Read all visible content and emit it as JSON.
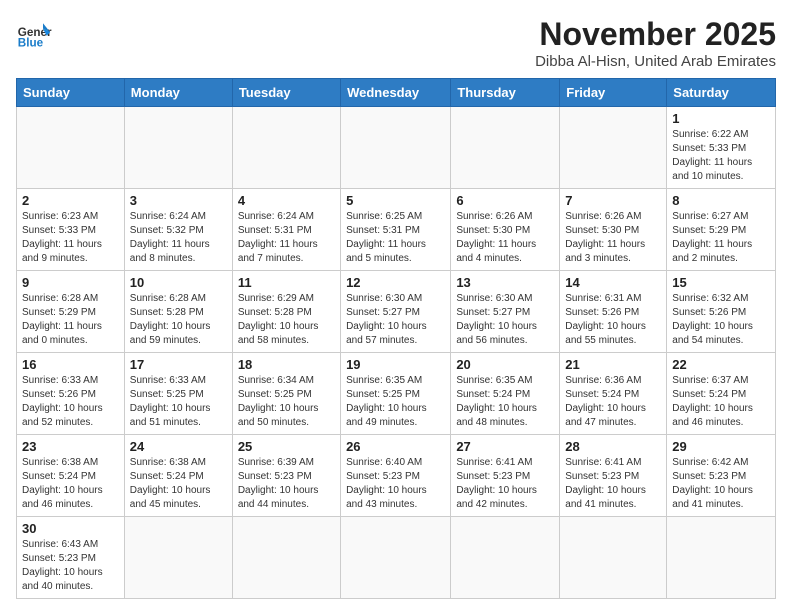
{
  "header": {
    "logo_general": "General",
    "logo_blue": "Blue",
    "month_title": "November 2025",
    "location": "Dibba Al-Hisn, United Arab Emirates"
  },
  "weekdays": [
    "Sunday",
    "Monday",
    "Tuesday",
    "Wednesday",
    "Thursday",
    "Friday",
    "Saturday"
  ],
  "weeks": [
    [
      {
        "day": "",
        "info": ""
      },
      {
        "day": "",
        "info": ""
      },
      {
        "day": "",
        "info": ""
      },
      {
        "day": "",
        "info": ""
      },
      {
        "day": "",
        "info": ""
      },
      {
        "day": "",
        "info": ""
      },
      {
        "day": "1",
        "info": "Sunrise: 6:22 AM\nSunset: 5:33 PM\nDaylight: 11 hours and 10 minutes."
      }
    ],
    [
      {
        "day": "2",
        "info": "Sunrise: 6:23 AM\nSunset: 5:33 PM\nDaylight: 11 hours and 9 minutes."
      },
      {
        "day": "3",
        "info": "Sunrise: 6:24 AM\nSunset: 5:32 PM\nDaylight: 11 hours and 8 minutes."
      },
      {
        "day": "4",
        "info": "Sunrise: 6:24 AM\nSunset: 5:31 PM\nDaylight: 11 hours and 7 minutes."
      },
      {
        "day": "5",
        "info": "Sunrise: 6:25 AM\nSunset: 5:31 PM\nDaylight: 11 hours and 5 minutes."
      },
      {
        "day": "6",
        "info": "Sunrise: 6:26 AM\nSunset: 5:30 PM\nDaylight: 11 hours and 4 minutes."
      },
      {
        "day": "7",
        "info": "Sunrise: 6:26 AM\nSunset: 5:30 PM\nDaylight: 11 hours and 3 minutes."
      },
      {
        "day": "8",
        "info": "Sunrise: 6:27 AM\nSunset: 5:29 PM\nDaylight: 11 hours and 2 minutes."
      }
    ],
    [
      {
        "day": "9",
        "info": "Sunrise: 6:28 AM\nSunset: 5:29 PM\nDaylight: 11 hours and 0 minutes."
      },
      {
        "day": "10",
        "info": "Sunrise: 6:28 AM\nSunset: 5:28 PM\nDaylight: 10 hours and 59 minutes."
      },
      {
        "day": "11",
        "info": "Sunrise: 6:29 AM\nSunset: 5:28 PM\nDaylight: 10 hours and 58 minutes."
      },
      {
        "day": "12",
        "info": "Sunrise: 6:30 AM\nSunset: 5:27 PM\nDaylight: 10 hours and 57 minutes."
      },
      {
        "day": "13",
        "info": "Sunrise: 6:30 AM\nSunset: 5:27 PM\nDaylight: 10 hours and 56 minutes."
      },
      {
        "day": "14",
        "info": "Sunrise: 6:31 AM\nSunset: 5:26 PM\nDaylight: 10 hours and 55 minutes."
      },
      {
        "day": "15",
        "info": "Sunrise: 6:32 AM\nSunset: 5:26 PM\nDaylight: 10 hours and 54 minutes."
      }
    ],
    [
      {
        "day": "16",
        "info": "Sunrise: 6:33 AM\nSunset: 5:26 PM\nDaylight: 10 hours and 52 minutes."
      },
      {
        "day": "17",
        "info": "Sunrise: 6:33 AM\nSunset: 5:25 PM\nDaylight: 10 hours and 51 minutes."
      },
      {
        "day": "18",
        "info": "Sunrise: 6:34 AM\nSunset: 5:25 PM\nDaylight: 10 hours and 50 minutes."
      },
      {
        "day": "19",
        "info": "Sunrise: 6:35 AM\nSunset: 5:25 PM\nDaylight: 10 hours and 49 minutes."
      },
      {
        "day": "20",
        "info": "Sunrise: 6:35 AM\nSunset: 5:24 PM\nDaylight: 10 hours and 48 minutes."
      },
      {
        "day": "21",
        "info": "Sunrise: 6:36 AM\nSunset: 5:24 PM\nDaylight: 10 hours and 47 minutes."
      },
      {
        "day": "22",
        "info": "Sunrise: 6:37 AM\nSunset: 5:24 PM\nDaylight: 10 hours and 46 minutes."
      }
    ],
    [
      {
        "day": "23",
        "info": "Sunrise: 6:38 AM\nSunset: 5:24 PM\nDaylight: 10 hours and 46 minutes."
      },
      {
        "day": "24",
        "info": "Sunrise: 6:38 AM\nSunset: 5:24 PM\nDaylight: 10 hours and 45 minutes."
      },
      {
        "day": "25",
        "info": "Sunrise: 6:39 AM\nSunset: 5:23 PM\nDaylight: 10 hours and 44 minutes."
      },
      {
        "day": "26",
        "info": "Sunrise: 6:40 AM\nSunset: 5:23 PM\nDaylight: 10 hours and 43 minutes."
      },
      {
        "day": "27",
        "info": "Sunrise: 6:41 AM\nSunset: 5:23 PM\nDaylight: 10 hours and 42 minutes."
      },
      {
        "day": "28",
        "info": "Sunrise: 6:41 AM\nSunset: 5:23 PM\nDaylight: 10 hours and 41 minutes."
      },
      {
        "day": "29",
        "info": "Sunrise: 6:42 AM\nSunset: 5:23 PM\nDaylight: 10 hours and 41 minutes."
      }
    ],
    [
      {
        "day": "30",
        "info": "Sunrise: 6:43 AM\nSunset: 5:23 PM\nDaylight: 10 hours and 40 minutes."
      },
      {
        "day": "",
        "info": ""
      },
      {
        "day": "",
        "info": ""
      },
      {
        "day": "",
        "info": ""
      },
      {
        "day": "",
        "info": ""
      },
      {
        "day": "",
        "info": ""
      },
      {
        "day": "",
        "info": ""
      }
    ]
  ]
}
